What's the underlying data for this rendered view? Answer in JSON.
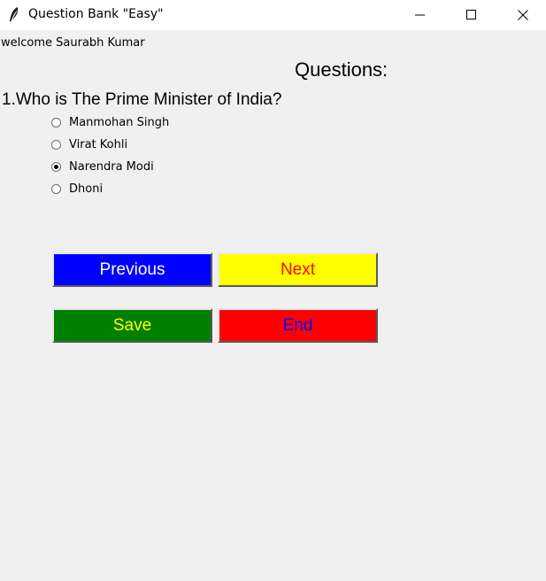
{
  "window": {
    "title": "Question Bank \"Easy\"",
    "icon": "feather-icon",
    "controls": [
      "minimize-icon",
      "maximize-icon",
      "close-icon"
    ]
  },
  "welcome_text": "welcome Saurabh Kumar",
  "heading": "Questions:",
  "question": {
    "text": "1.Who is The Prime Minister of India?",
    "options": [
      {
        "label": "Manmohan Singh",
        "selected": false
      },
      {
        "label": "Virat Kohli",
        "selected": false
      },
      {
        "label": "Narendra Modi",
        "selected": true
      },
      {
        "label": "Dhoni",
        "selected": false
      }
    ]
  },
  "buttons": {
    "previous": {
      "label": "Previous",
      "bg": "#0000ff",
      "fg": "#ffffff"
    },
    "next": {
      "label": "Next",
      "bg": "#ffff00",
      "fg": "#ff0000"
    },
    "save": {
      "label": "Save",
      "bg": "#008000",
      "fg": "#ffff00"
    },
    "end": {
      "label": "End",
      "bg": "#ff0000",
      "fg": "#0000ff"
    }
  }
}
